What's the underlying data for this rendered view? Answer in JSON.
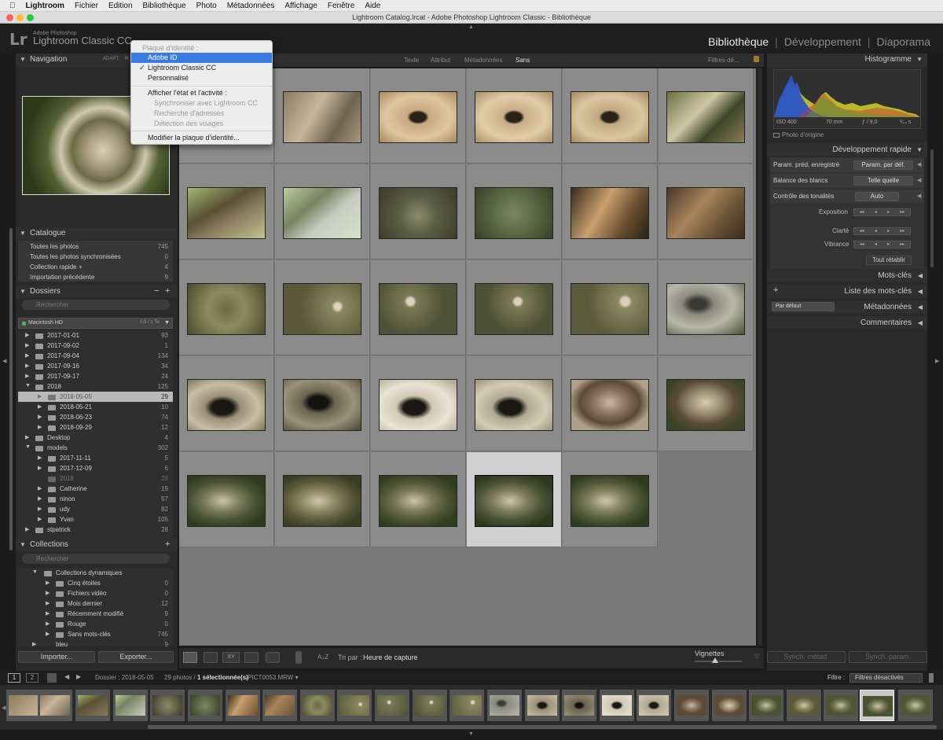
{
  "mac_menu": {
    "apple": "",
    "app": "Lightroom",
    "items": [
      "Fichier",
      "Edition",
      "Bibliothèque",
      "Photo",
      "Métadonnées",
      "Affichage",
      "Fenêtre",
      "Aide"
    ]
  },
  "window_title": "Lightroom Catalog.lrcat - Adobe Photoshop Lightroom Classic - Bibliothèque",
  "header": {
    "logo": "Lr",
    "brand_small": "Adobe Photoshop",
    "brand_large": "Lightroom Classic CC",
    "modules": [
      "Bibliothèque",
      "Développement",
      "Diaporama"
    ],
    "separator": "|"
  },
  "identity_menu": {
    "section1": "Plaque d'identité :",
    "adobe_id": "Adobe ID",
    "lightroom": "Lightroom Classic CC",
    "custom": "Personnalisé",
    "section2": "Afficher l'état et l'activité :",
    "sync": "Synchroniser avec Lightroom CC",
    "addresses": "Recherche d'adresses",
    "faces": "Détection des visages",
    "edit": "Modifier la plaque d'identité..."
  },
  "left": {
    "navigation": {
      "title": "Navigation",
      "adapt": "ADAPT.",
      "r": "R"
    },
    "catalogue": {
      "title": "Catalogue",
      "items": [
        {
          "label": "Toutes les photos",
          "count": "745"
        },
        {
          "label": "Toutes les photos synchronisées",
          "count": "0"
        },
        {
          "label": "Collection rapide +",
          "count": "4"
        },
        {
          "label": "Importation précédente",
          "count": "9"
        }
      ]
    },
    "dossiers": {
      "title": "Dossiers",
      "minus": "−",
      "plus": "+",
      "search": "Rechercher",
      "volume": "Macintosh HD",
      "volume_size": "0,9 / 1 To",
      "items": [
        {
          "label": "2017-01-01",
          "count": "93"
        },
        {
          "label": "2017-09-02",
          "count": "1"
        },
        {
          "label": "2017-09-04",
          "count": "134"
        },
        {
          "label": "2017-09-16",
          "count": "34"
        },
        {
          "label": "2017-09-17",
          "count": "24"
        },
        {
          "label": "2018",
          "count": "125"
        },
        {
          "label": "2018-05-05",
          "count": "29"
        },
        {
          "label": "2018-05-21",
          "count": "10"
        },
        {
          "label": "2018-06-23",
          "count": "74"
        },
        {
          "label": "2018-09-29",
          "count": "12"
        },
        {
          "label": "Desktop",
          "count": "4"
        },
        {
          "label": "models",
          "count": "302"
        },
        {
          "label": "2017-11-11",
          "count": "5"
        },
        {
          "label": "2017-12-09",
          "count": "6"
        },
        {
          "label": "2018",
          "count": "28"
        },
        {
          "label": "Catherine",
          "count": "19"
        },
        {
          "label": "ninon",
          "count": "57"
        },
        {
          "label": "udy",
          "count": "82"
        },
        {
          "label": "Yvan",
          "count": "105"
        },
        {
          "label": "stpatrick",
          "count": "28"
        }
      ]
    },
    "collections": {
      "title": "Collections",
      "plus": "+",
      "search": "Rechercher",
      "group": "Collections dynamiques",
      "items": [
        {
          "label": "Cinq étoiles",
          "count": "0"
        },
        {
          "label": "Fichiers vidéo",
          "count": "0"
        },
        {
          "label": "Mois dernier",
          "count": "12"
        },
        {
          "label": "Récemment modifié",
          "count": "9"
        },
        {
          "label": "Rouge",
          "count": "0"
        },
        {
          "label": "Sans mots-clés",
          "count": "745"
        },
        {
          "label": "bleu",
          "count": "9"
        }
      ]
    },
    "import_btn": "Importer...",
    "export_btn": "Exporter..."
  },
  "filter_bar": {
    "tabs": [
      "Texte",
      "Attribut",
      "Métadonnées",
      "Sans"
    ],
    "active": "Sans",
    "filters": "Filtres dé..."
  },
  "toolbar": {
    "sort_label": "Tri par :",
    "sort_value": "Heure de capture",
    "thumbs": "Vignettes",
    "az": "A↓Z"
  },
  "right": {
    "histogram": {
      "title": "Histogramme",
      "iso": "ISO 400",
      "focal": "70 mm",
      "aperture": "ƒ / 9,0",
      "shutter": "¹⁄₁₀ s",
      "original": "Photo d'origine"
    },
    "quick_dev": {
      "title": "Développement rapide",
      "preset_label": "Param. préd. enregistré",
      "preset_value": "Param. par déf.",
      "wb_label": "Balance des blancs",
      "wb_value": "Telle quelle",
      "tone_label": "Contrôle des tonalités",
      "tone_value": "Auto",
      "exposure": "Exposition",
      "clarity": "Clarté",
      "vibrance": "Vibrance",
      "reset": "Tout rétablir"
    },
    "keywords": "Mots-clés",
    "keyword_list": "Liste des mots-clés",
    "metadata_select": "Par défaut",
    "metadata": "Métadonnées",
    "comments": "Commentaires",
    "sync_meta": "Synch. métad.",
    "sync_param": "Synch. param."
  },
  "filmbar": {
    "page1": "1",
    "page2": "2",
    "folder": "Dossier : 2018-05-05",
    "count": "29 photos /",
    "selected": "1 sélectionnée(s)",
    "file": "/PICT0053.MRW ▾",
    "filter_label": "Filtre :",
    "filter_value": "Filtres désactivés"
  }
}
